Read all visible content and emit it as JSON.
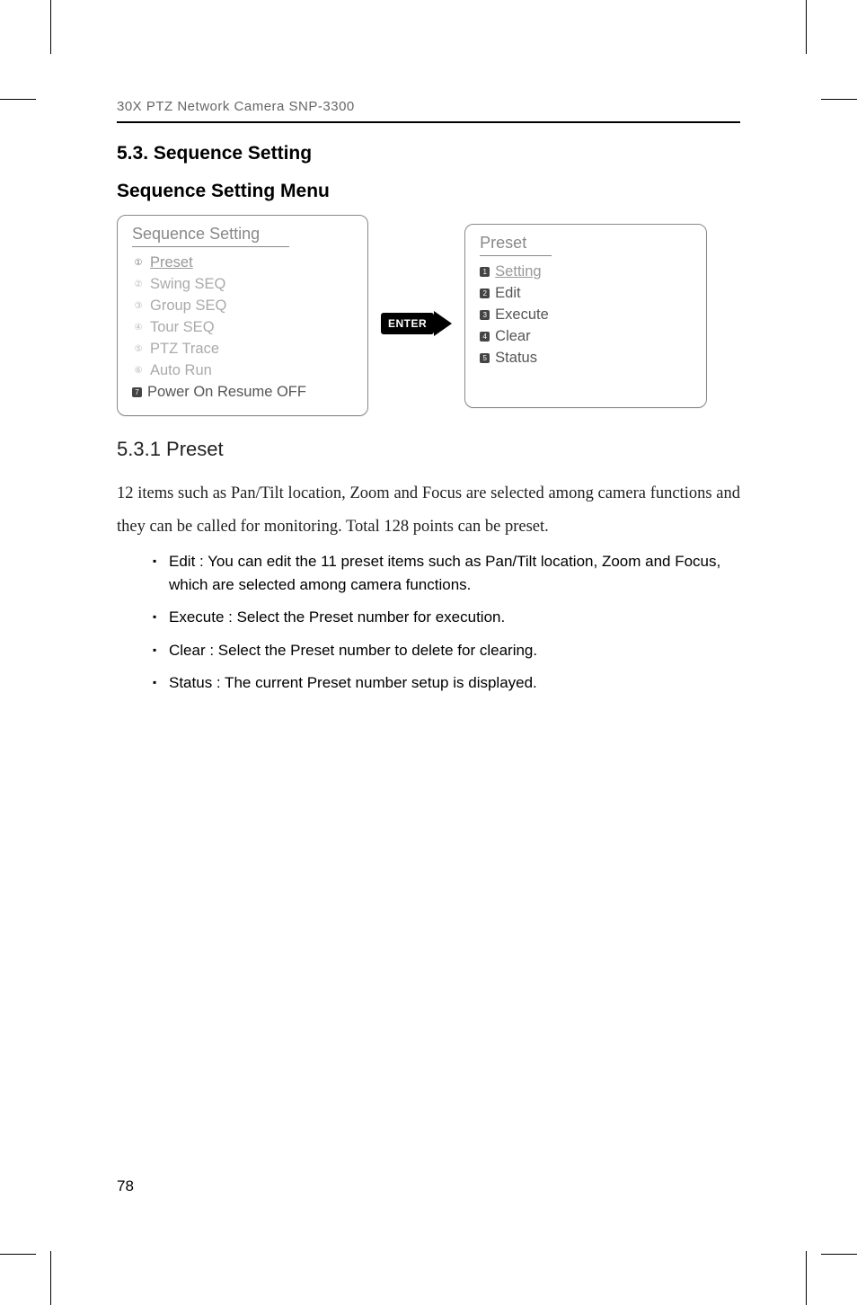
{
  "header": "30X PTZ Network Camera SNP-3300",
  "section_title": "5.3. Sequence Setting",
  "menu_title": "Sequence Setting Menu",
  "left_box": {
    "title": "Sequence Setting",
    "items": [
      "Preset",
      "Swing SEQ",
      "Group SEQ",
      "Tour SEQ",
      "PTZ Trace",
      "Auto Run",
      "Power On Resume OFF"
    ]
  },
  "enter_label": "ENTER",
  "right_box": {
    "title": "Preset",
    "items": [
      "Setting",
      "Edit",
      "Execute",
      "Clear",
      "Status"
    ]
  },
  "subsection_title": "5.3.1 Preset",
  "body_para": "12 items such as Pan/Tilt location, Zoom and Focus are selected among camera functions and they can be called for monitoring. Total 128 points can be preset.",
  "bullets": [
    "Edit : You can edit the 11 preset items such as Pan/Tilt location, Zoom and Focus, which are selected among camera functions.",
    "Execute : Select the Preset number for execution.",
    "Clear : Select the Preset number to delete for clearing.",
    "Status : The current Preset number setup is displayed."
  ],
  "page_number": "78"
}
